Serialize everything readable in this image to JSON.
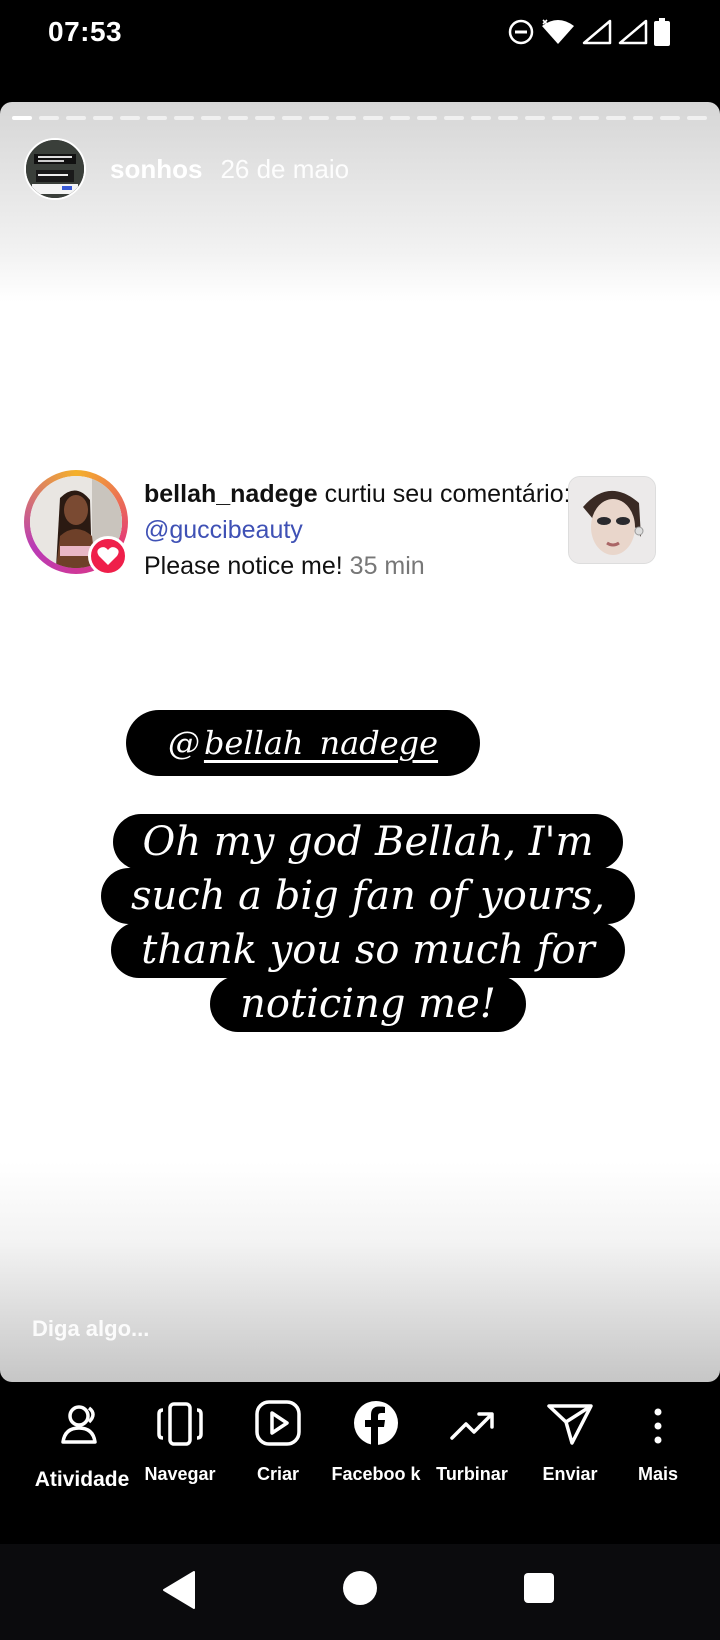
{
  "status": {
    "time": "07:53",
    "icons": [
      "dnd-icon",
      "wifi-icon",
      "signal-icon",
      "signal-icon",
      "battery-icon"
    ]
  },
  "story": {
    "username": "sonhos",
    "date": "26 de maio",
    "reply_placeholder": "Diga algo..."
  },
  "notification": {
    "username": "bellah_nadege",
    "text_liked": " curtiu seu comentário: ",
    "mention": "@guccibeauty",
    "comment": "Please notice me!",
    "time": "35 min"
  },
  "mention_sticker": {
    "at": "@",
    "handle": "bellah_nadege"
  },
  "caption": {
    "lines": [
      "Oh my god Bellah, I'm",
      "such a big fan of yours,",
      "thank you so much for",
      "noticing me!"
    ]
  },
  "actions": [
    {
      "label": "Atividade",
      "icon": "activity-icon"
    },
    {
      "label": "Navegar",
      "icon": "browse-icon"
    },
    {
      "label": "Criar",
      "icon": "create-icon"
    },
    {
      "label": "Faceboo k",
      "icon": "facebook-icon"
    },
    {
      "label": "Turbinar",
      "icon": "boost-icon"
    },
    {
      "label": "Enviar",
      "icon": "send-icon"
    },
    {
      "label": "Mais",
      "icon": "more-icon"
    }
  ],
  "colors": {
    "mention": "#3f51b5",
    "heart_badge": "#ef1f4a",
    "sticker_bg": "#000000"
  }
}
